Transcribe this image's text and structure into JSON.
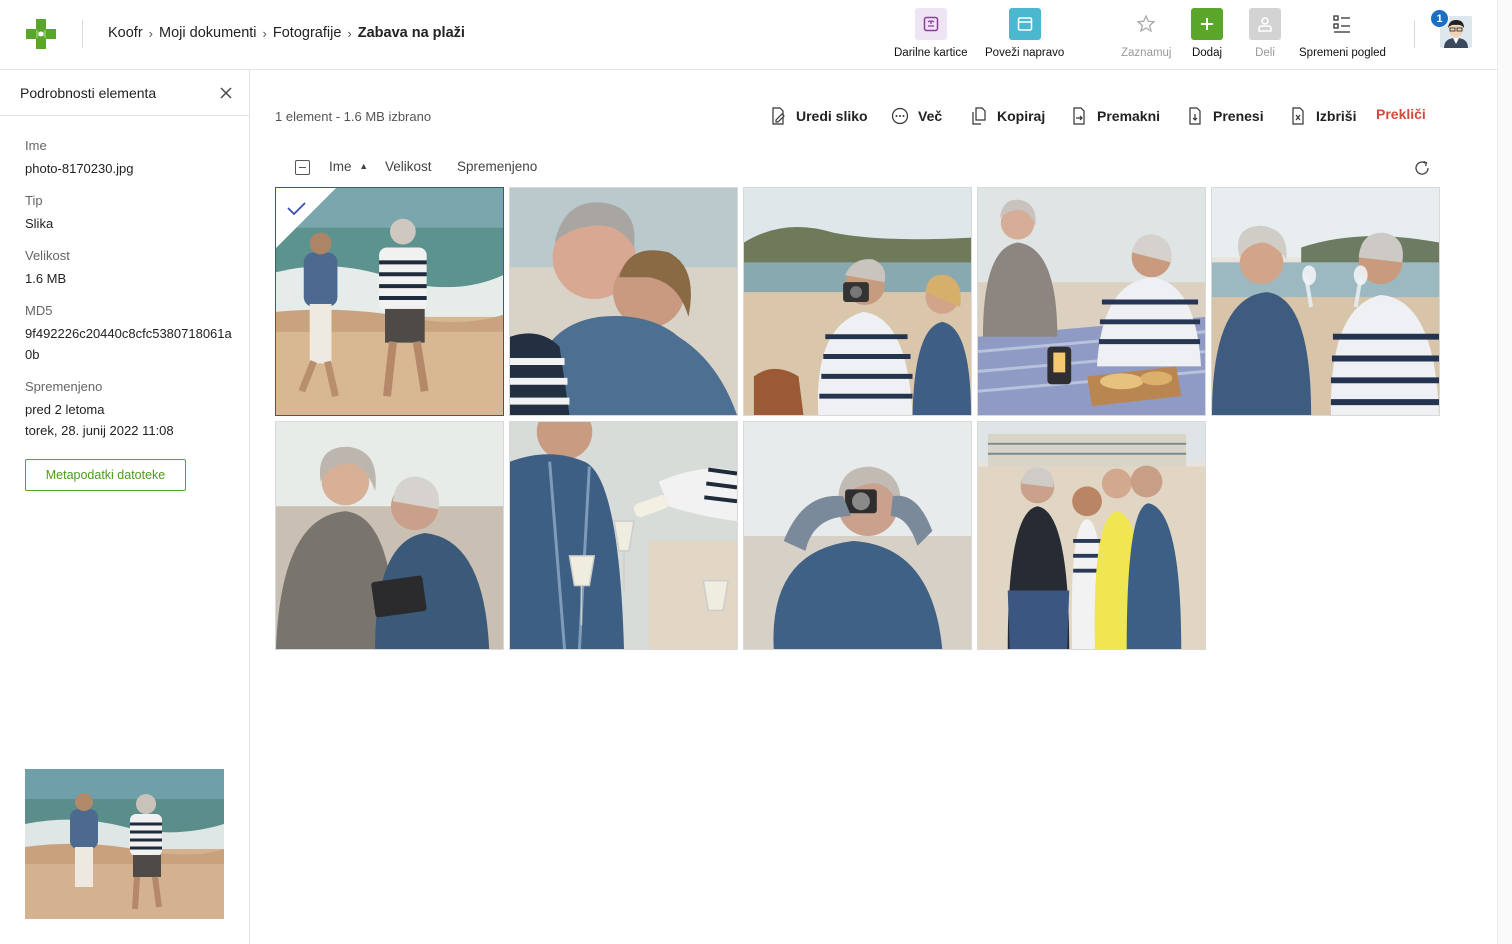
{
  "breadcrumb": [
    "Koofr",
    "Moji dokumenti",
    "Fotografije",
    "Zabava na plaži"
  ],
  "header_actions": {
    "gift_cards": "Darilne kartice",
    "connect_device": "Poveži napravo",
    "bookmark": "Zaznamuj",
    "add": "Dodaj",
    "share": "Deli",
    "change_view": "Spremeni pogled"
  },
  "notifications_count": "1",
  "sidebar": {
    "title": "Podrobnosti elementa",
    "name_label": "Ime",
    "name_value": "photo-8170230.jpg",
    "type_label": "Tip",
    "type_value": "Slika",
    "size_label": "Velikost",
    "size_value": "1.6 MB",
    "md5_label": "MD5",
    "md5_value": "9f492226c20440c8cfc5380718061a0b",
    "modified_label": "Spremenjeno",
    "modified_relative": "pred 2 letoma",
    "modified_date": "torek, 28. junij 2022 11:08",
    "metadata_button": "Metapodatki datoteke"
  },
  "selection_info": "1 element - 1.6 MB izbrano",
  "actions": {
    "edit_image": "Uredi sliko",
    "more": "Več",
    "copy": "Kopiraj",
    "move": "Premakni",
    "download": "Prenesi",
    "delete": "Izbriši",
    "cancel": "Prekliči"
  },
  "sort": {
    "name": "Ime",
    "size": "Velikost",
    "modified": "Spremenjeno"
  },
  "colors": {
    "brand_green": "#5aa62a",
    "cancel_red": "#d24a3a",
    "selection_blue": "#3a4fb0",
    "badge_blue": "#1a6fc4"
  }
}
